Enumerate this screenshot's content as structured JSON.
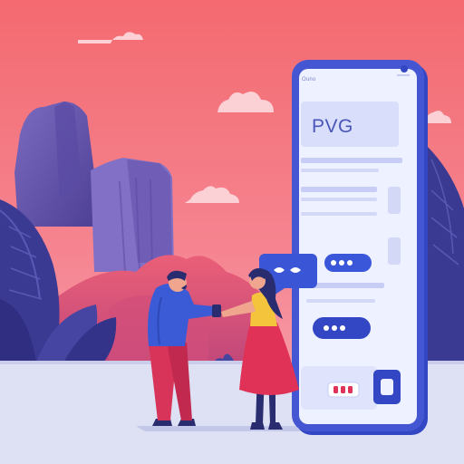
{
  "illustration": {
    "subject": "two-people-exchanging-phone-in-front-of-giant-smartphone",
    "colors": {
      "sky_top": "#f46a70",
      "sky_bottom": "#f7a3b0",
      "ground": "#dfe3f4",
      "mountain_dark": "#6a5aae",
      "mountain_mid": "#8a78c4",
      "hill_red": "#e75a73",
      "foliage_dark": "#3c3c94",
      "phone_frame": "#3347c4",
      "phone_screen": "#edf0ff",
      "accent_blue": "#3b57d9",
      "accent_red": "#e03256"
    }
  },
  "phone": {
    "brand": "Ouno",
    "title": "PVG"
  }
}
